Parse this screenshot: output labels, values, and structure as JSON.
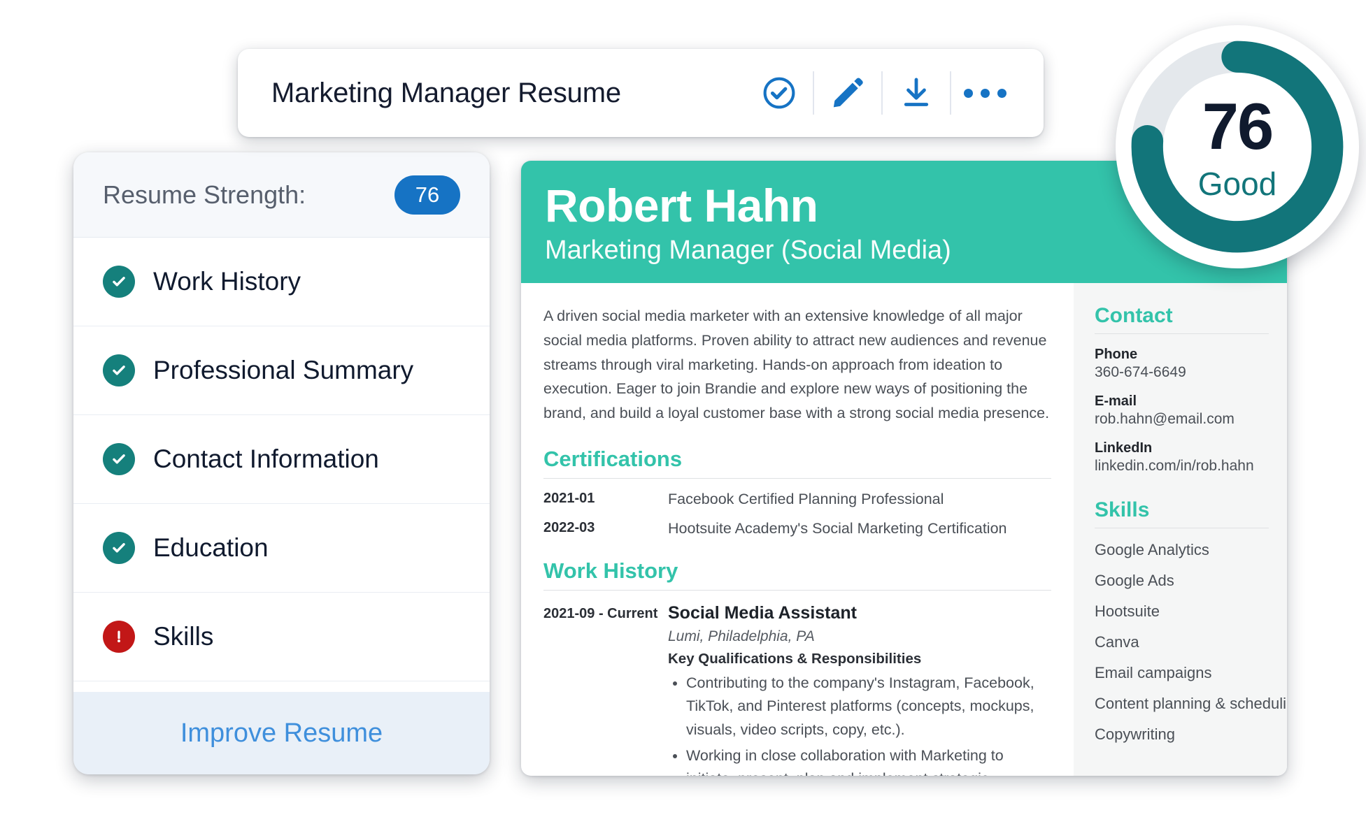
{
  "toolbar": {
    "title": "Marketing Manager Resume",
    "actions": [
      {
        "name": "check-circle-icon",
        "label": "Check"
      },
      {
        "name": "pencil-icon",
        "label": "Edit"
      },
      {
        "name": "download-icon",
        "label": "Download"
      },
      {
        "name": "more-options-icon",
        "label": "More options"
      }
    ],
    "accent_color": "#1673c4"
  },
  "score_badge": {
    "value": "76",
    "rating": "Good",
    "percent": 76,
    "arc_color": "#12757a",
    "track_color": "#e4e8ec"
  },
  "strength_panel": {
    "heading": "Resume Strength:",
    "score": "76",
    "score_pill_color": "#1673c4",
    "items": [
      {
        "label": "Work History",
        "status": "ok",
        "icon": "check-circle-icon"
      },
      {
        "label": "Professional Summary",
        "status": "ok",
        "icon": "check-circle-icon"
      },
      {
        "label": "Contact Information",
        "status": "ok",
        "icon": "check-circle-icon"
      },
      {
        "label": "Education",
        "status": "ok",
        "icon": "check-circle-icon"
      },
      {
        "label": "Skills",
        "status": "alert",
        "icon": "alert-circle-icon"
      }
    ],
    "ok_color": "#15807c",
    "alert_color": "#c21717",
    "improve_label": "Improve Resume",
    "improve_color": "#3f8fdc"
  },
  "resume": {
    "accent_color": "#33c3aa",
    "name": "Robert Hahn",
    "role": "Marketing Manager (Social Media)",
    "summary": "A driven social media marketer with an extensive knowledge of all major social media platforms. Proven ability to attract new audiences and revenue streams through viral marketing. Hands-on approach from ideation to execution. Eager to join Brandie and explore new ways of positioning the brand, and build a loyal customer base with a strong social media presence.",
    "certifications": {
      "title": "Certifications",
      "entries": [
        {
          "date": "2021-01",
          "name": "Facebook Certified Planning Professional"
        },
        {
          "date": "2022-03",
          "name": "Hootsuite Academy's Social Marketing Certification"
        }
      ]
    },
    "work_history": {
      "title": "Work History",
      "entries": [
        {
          "date": "2021-09 - Current",
          "title": "Social Media Assistant",
          "company": "Lumi, Philadelphia, PA",
          "bullets_heading": "Key Qualifications & Responsibilities",
          "bullets": [
            "Contributing to the company's Instagram, Facebook, TikTok, and Pinterest platforms (concepts, mockups, visuals, video scripts, copy, etc.).",
            "Working in close collaboration with Marketing to initiate, present, plan and implement strategic marketing initiatives"
          ]
        }
      ]
    },
    "sidebar": {
      "contact": {
        "title": "Contact",
        "fields": [
          {
            "label": "Phone",
            "value": "360-674-6649"
          },
          {
            "label": "E-mail",
            "value": "rob.hahn@email.com"
          },
          {
            "label": "LinkedIn",
            "value": "linkedin.com/in/rob.hahn"
          }
        ]
      },
      "skills": {
        "title": "Skills",
        "items": [
          "Google Analytics",
          "Google Ads",
          "Hootsuite",
          "Canva",
          "Email campaigns",
          "Content planning & scheduling",
          "Copywriting"
        ]
      }
    }
  }
}
